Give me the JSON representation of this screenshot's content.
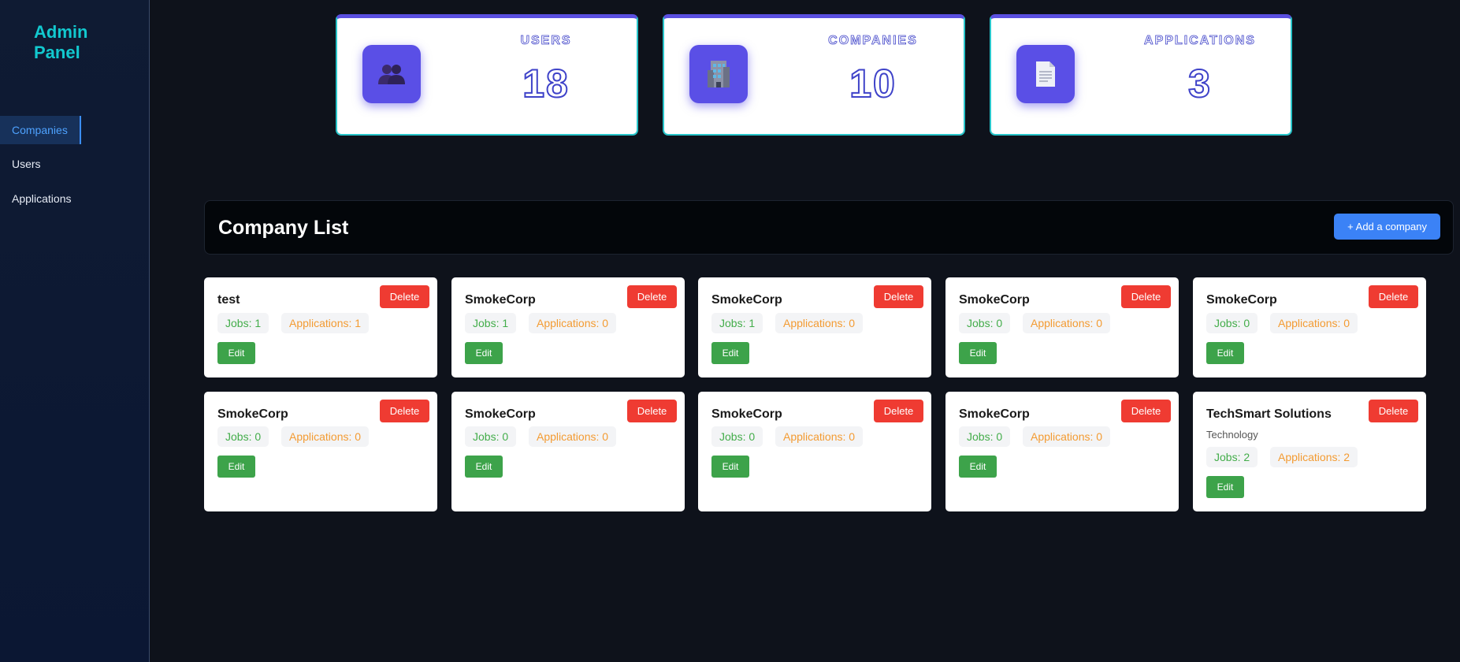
{
  "sidebar": {
    "brand": "Admin Panel",
    "items": [
      {
        "label": "Companies",
        "active": true
      },
      {
        "label": "Users",
        "active": false
      },
      {
        "label": "Applications",
        "active": false
      }
    ]
  },
  "stats": [
    {
      "title": "USERS",
      "value": "18",
      "icon": "users-icon"
    },
    {
      "title": "COMPANIES",
      "value": "10",
      "icon": "building-icon"
    },
    {
      "title": "APPLICATIONS",
      "value": "3",
      "icon": "document-icon"
    }
  ],
  "company_list": {
    "title": "Company List",
    "add_button": "+ Add a company",
    "companies": [
      {
        "name": "test",
        "industry": "",
        "jobs": "Jobs: 1",
        "applications": "Applications: 1"
      },
      {
        "name": "SmokeCorp",
        "industry": "",
        "jobs": "Jobs: 1",
        "applications": "Applications: 0"
      },
      {
        "name": "SmokeCorp",
        "industry": "",
        "jobs": "Jobs: 1",
        "applications": "Applications: 0"
      },
      {
        "name": "SmokeCorp",
        "industry": "",
        "jobs": "Jobs: 0",
        "applications": "Applications: 0"
      },
      {
        "name": "SmokeCorp",
        "industry": "",
        "jobs": "Jobs: 0",
        "applications": "Applications: 0"
      },
      {
        "name": "SmokeCorp",
        "industry": "",
        "jobs": "Jobs: 0",
        "applications": "Applications: 0"
      },
      {
        "name": "SmokeCorp",
        "industry": "",
        "jobs": "Jobs: 0",
        "applications": "Applications: 0"
      },
      {
        "name": "SmokeCorp",
        "industry": "",
        "jobs": "Jobs: 0",
        "applications": "Applications: 0"
      },
      {
        "name": "SmokeCorp",
        "industry": "",
        "jobs": "Jobs: 0",
        "applications": "Applications: 0"
      },
      {
        "name": "TechSmart Solutions",
        "industry": "Technology",
        "jobs": "Jobs: 2",
        "applications": "Applications: 2"
      }
    ],
    "delete_label": "Delete",
    "edit_label": "Edit"
  },
  "colors": {
    "accent": "#5a4fe6",
    "cyan": "#12c9cf",
    "delete": "#ef3b32",
    "edit": "#3da34a",
    "primary": "#3b82f6"
  }
}
